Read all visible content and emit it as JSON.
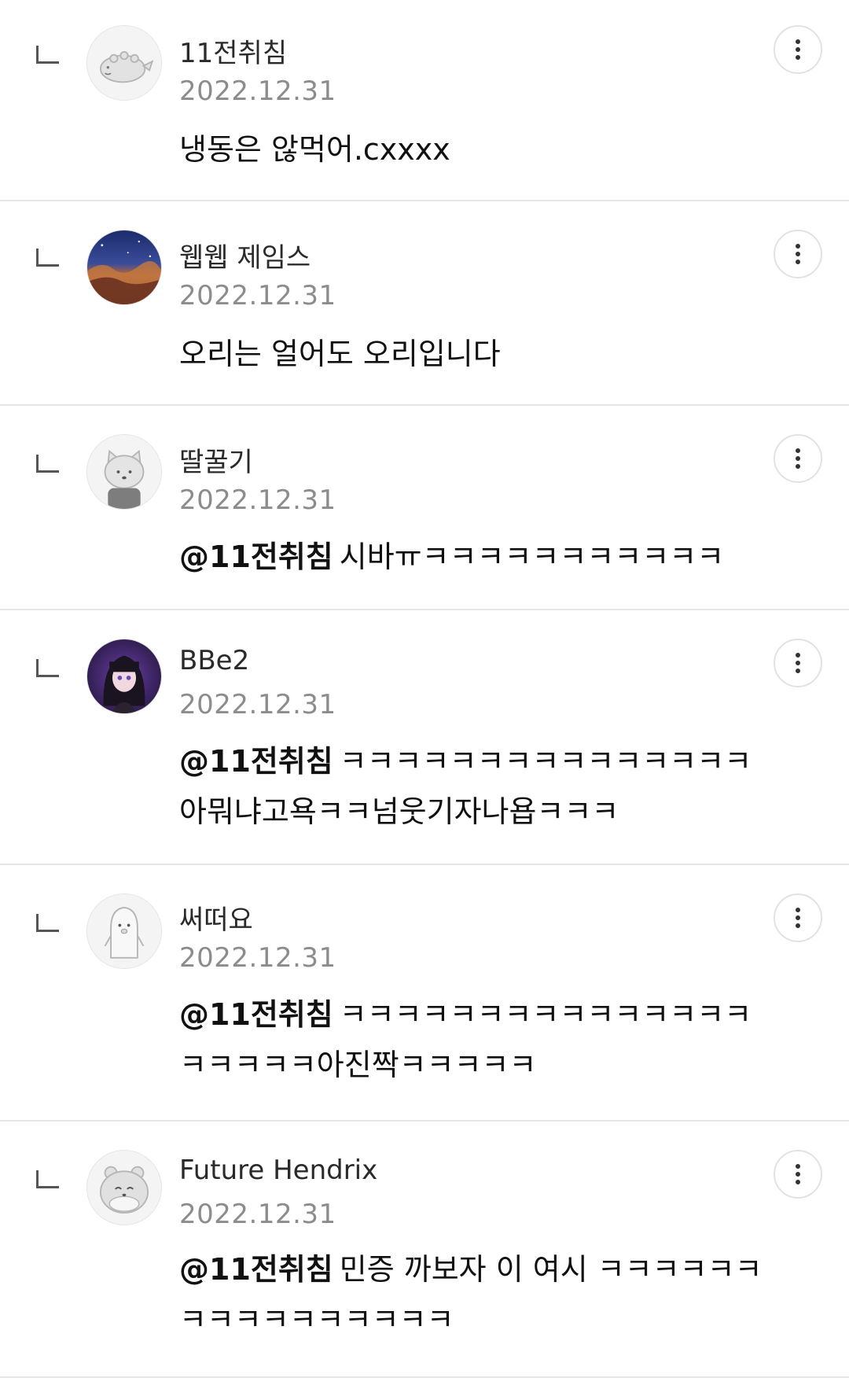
{
  "comments": [
    {
      "author": "11전취침",
      "date": "2022.12.31",
      "mention": "",
      "text": "냉동은 않먹어.cxxxx",
      "avatar_icon": "dinosaur-avatar-icon"
    },
    {
      "author": "웹웹 제임스",
      "date": "2022.12.31",
      "mention": "",
      "text": "오리는 얼어도 오리입니다",
      "avatar_icon": "nebula-photo-avatar-icon"
    },
    {
      "author": "딸꿀기",
      "date": "2022.12.31",
      "mention": "@11전취침",
      "text": "시바ㅠㅋㅋㅋㅋㅋㅋㅋㅋㅋㅋㅋ",
      "avatar_icon": "cat-avatar-icon"
    },
    {
      "author": "BBe2",
      "date": "2022.12.31",
      "mention": "@11전취침",
      "text": "ㅋㅋㅋㅋㅋㅋㅋㅋㅋㅋㅋㅋㅋㅋㅋ아뭐냐고욕ㅋㅋ넘웃기자나욥ㅋㅋㅋ",
      "avatar_icon": "anime-girl-avatar-icon"
    },
    {
      "author": "써떠요",
      "date": "2022.12.31",
      "mention": "@11전취침",
      "text": "ㅋㅋㅋㅋㅋㅋㅋㅋㅋㅋㅋㅋㅋㅋㅋㅋㅋㅋㅋㅋ아진짝ㅋㅋㅋㅋㅋ",
      "avatar_icon": "penguin-avatar-icon"
    },
    {
      "author": "Future Hendrix",
      "date": "2022.12.31",
      "mention": "@11전취침",
      "text": "민증 까보자 이 여시 ㅋㅋㅋㅋㅋㅋㅋㅋㅋㅋㅋㅋㅋㅋㅋㅋ",
      "avatar_icon": "hamster-avatar-icon"
    }
  ]
}
